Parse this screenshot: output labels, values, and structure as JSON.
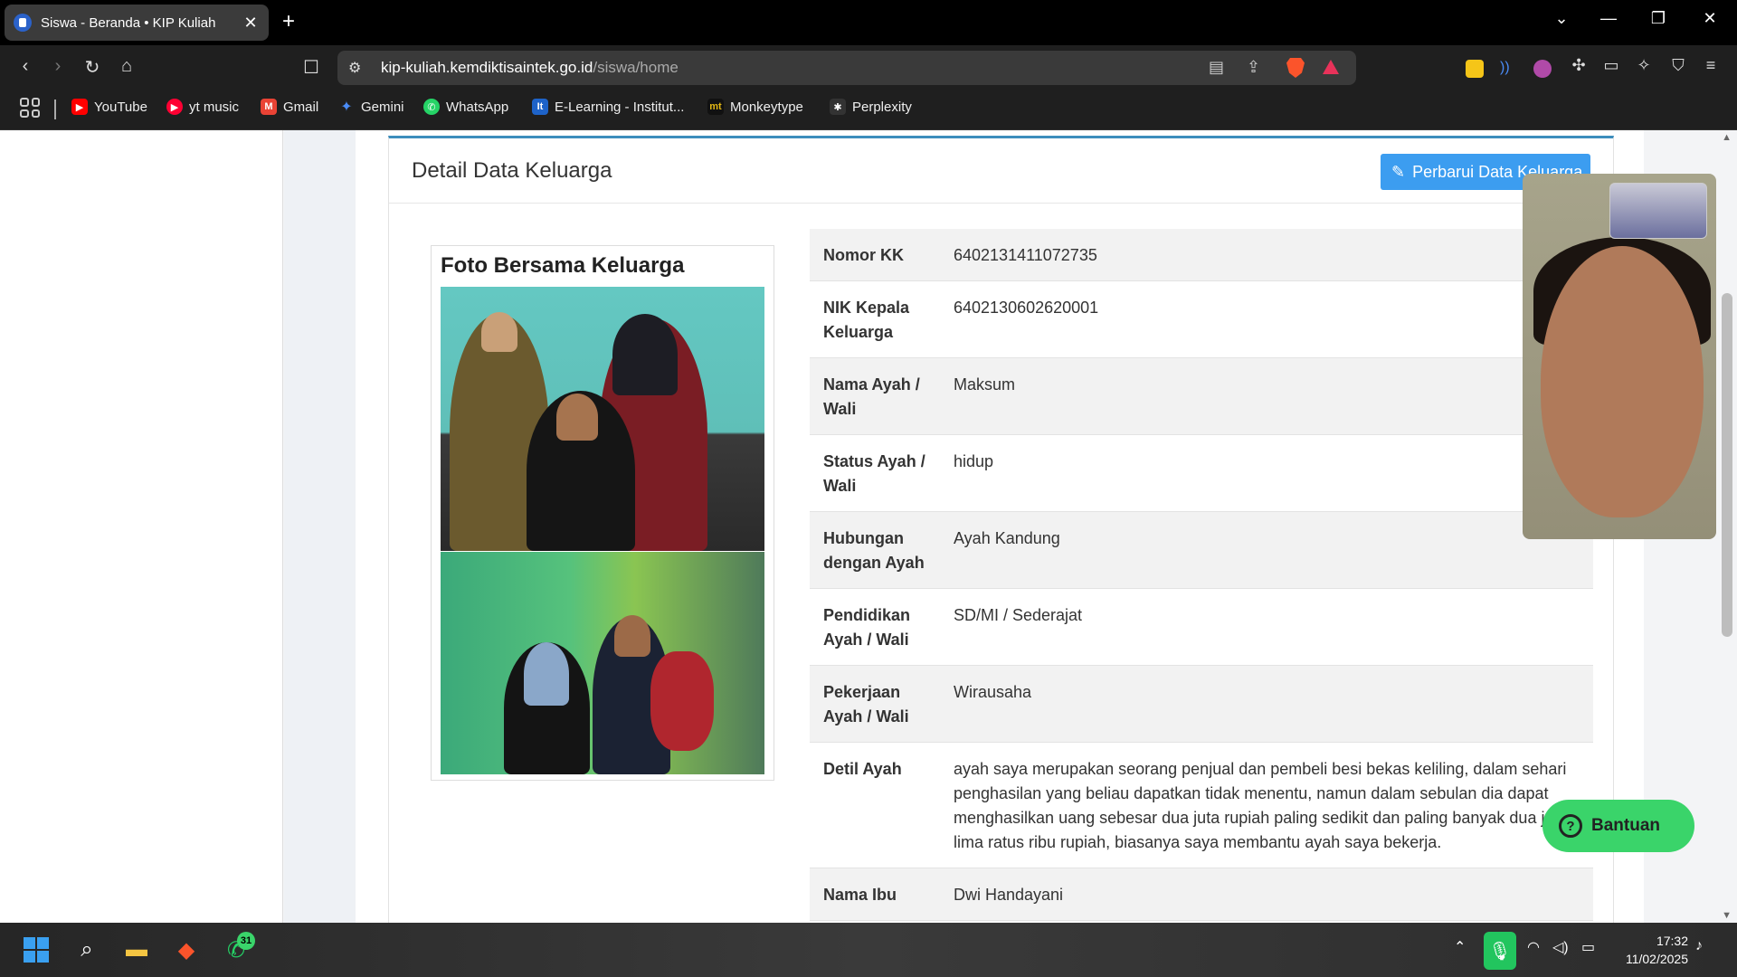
{
  "browser": {
    "tab_title": "Siswa - Beranda • KIP Kuliah",
    "url_domain": "kip-kuliah.kemdiktisaintek.go.id",
    "url_path": "/siswa/home",
    "bookmarks": [
      {
        "label": "YouTube",
        "color": "#ff0000"
      },
      {
        "label": "yt music",
        "color": "#ff0033"
      },
      {
        "label": "Gmail",
        "color": "#ea4335"
      },
      {
        "label": "Gemini",
        "color": "#4a8cf7"
      },
      {
        "label": "WhatsApp",
        "color": "#25d366"
      },
      {
        "label": "E-Learning - Institut...",
        "color": "#1e63c9"
      },
      {
        "label": "Monkeytype",
        "color": "#111111"
      },
      {
        "label": "Perplexity",
        "color": "#333333"
      }
    ]
  },
  "card": {
    "title": "Detail Data Keluarga",
    "update_button": "Perbarui Data Keluarga",
    "photo_title": "Foto Bersama Keluarga"
  },
  "rows": [
    {
      "label": "Nomor KK",
      "value": "6402131411072735"
    },
    {
      "label": "NIK Kepala Keluarga",
      "value": "6402130602620001"
    },
    {
      "label": "Nama Ayah / Wali",
      "value": "Maksum"
    },
    {
      "label": "Status Ayah / Wali",
      "value": "hidup"
    },
    {
      "label": "Hubungan dengan Ayah",
      "value": "Ayah Kandung"
    },
    {
      "label": "Pendidikan Ayah / Wali",
      "value": "SD/MI / Sederajat"
    },
    {
      "label": "Pekerjaan Ayah / Wali",
      "value": "Wirausaha"
    },
    {
      "label": "Detil Ayah",
      "value": "ayah saya merupakan seorang penjual dan pembeli besi bekas keliling, dalam sehari penghasilan yang beliau dapatkan tidak menentu, namun dalam sebulan dia dapat menghasilkan uang sebesar dua juta rupiah paling sedikit dan paling banyak dua juta lima ratus ribu rupiah, biasanya saya membantu ayah saya bekerja."
    },
    {
      "label": "Nama Ibu",
      "value": "Dwi Handayani"
    }
  ],
  "help_button": "Bantuan",
  "taskbar": {
    "whatsapp_badge": "31",
    "time": "17:32",
    "date": "11/02/2025"
  }
}
